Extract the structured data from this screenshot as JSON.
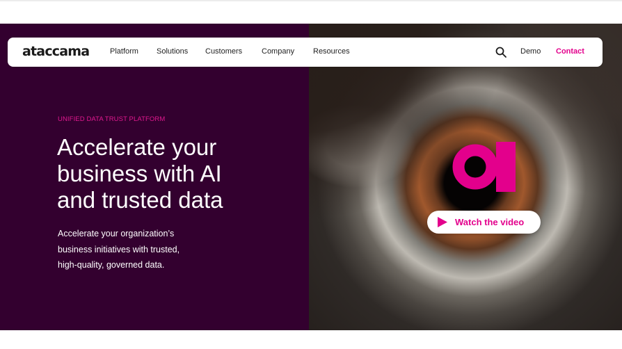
{
  "brand": {
    "logo_text": "ataccama",
    "accent_color": "#e3008c",
    "hero_bg_color": "#33002f"
  },
  "nav": {
    "items": [
      {
        "label": "Platform"
      },
      {
        "label": "Solutions"
      },
      {
        "label": "Customers"
      },
      {
        "label": "Company"
      },
      {
        "label": "Resources"
      }
    ],
    "search_icon": "search-icon",
    "demo_label": "Demo",
    "contact_label": "Contact"
  },
  "hero": {
    "eyebrow": "UNIFIED DATA TRUST PLATFORM",
    "headline_lines": [
      "Accelerate your",
      "business with AI",
      "and trusted data"
    ],
    "subtext_lines": [
      "Accelerate your organization’s",
      "business initiatives with trusted,",
      "high-quality, governed data."
    ]
  },
  "video": {
    "badge_icon": "ai-logo-icon",
    "play_icon": "play-icon",
    "button_label": "Watch the video"
  }
}
